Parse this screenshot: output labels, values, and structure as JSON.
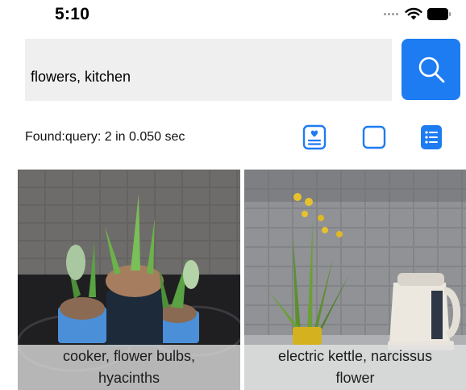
{
  "status_bar": {
    "time": "5:10",
    "icons": [
      "signal-dots-icon",
      "wifi-icon",
      "battery-icon"
    ]
  },
  "search": {
    "value": "flowers, kitchen",
    "button_icon": "search-icon"
  },
  "results_info": {
    "text": "Found:query: 2 in 0.050 sec"
  },
  "view_modes": [
    {
      "icon": "card-view-icon",
      "selected": false
    },
    {
      "icon": "single-view-icon",
      "selected": false
    },
    {
      "icon": "list-view-icon",
      "selected": true
    }
  ],
  "results": [
    {
      "caption": "cooker, flower bulbs, hyacinths"
    },
    {
      "caption": "electric kettle, narcissus flower"
    }
  ],
  "colors": {
    "accent": "#1e7cf2",
    "search_bg": "#efeff0",
    "caption_bg": "#e1e1e1"
  }
}
